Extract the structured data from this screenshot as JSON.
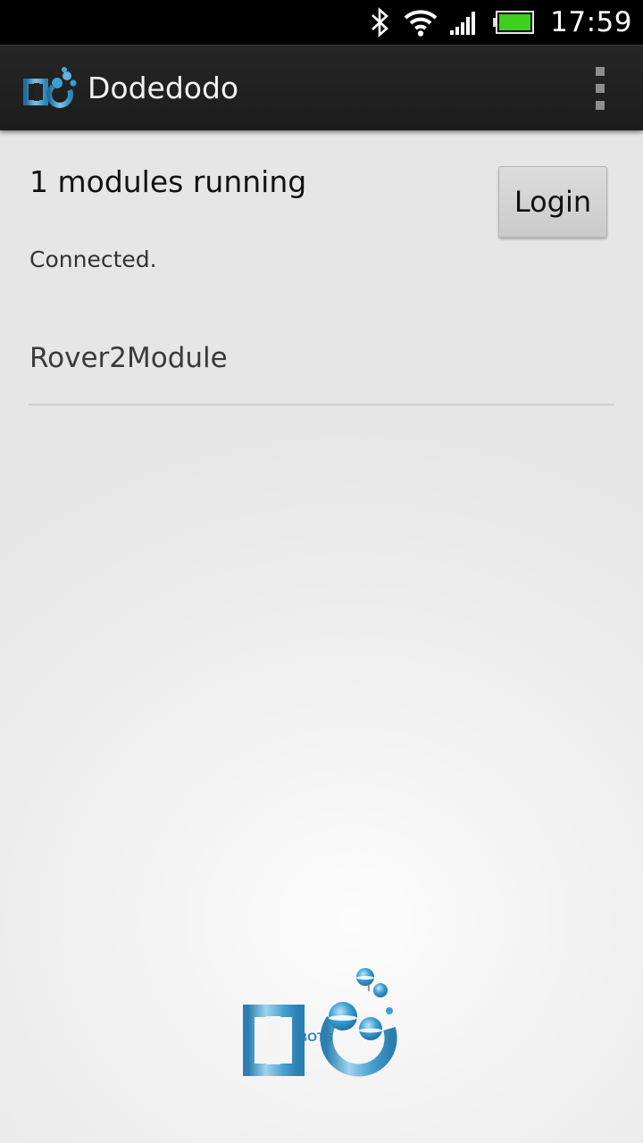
{
  "status_bar": {
    "time": "17:59",
    "icons": [
      "bluetooth-icon",
      "wifi-icon",
      "signal-icon",
      "battery-icon"
    ],
    "battery_color": "#3fcf1f"
  },
  "action_bar": {
    "title": "Dodedodo",
    "logo_text": "BOTS",
    "menu_icon": "overflow-menu-icon"
  },
  "main": {
    "modules_running": "1 modules running",
    "login_label": "Login",
    "connection_status": "Connected.",
    "modules": [
      {
        "name": "Rover2Module"
      }
    ]
  },
  "footer": {
    "logo_text": "BOTS"
  },
  "colors": {
    "accent_blue": "#3a9fd3",
    "action_bar": "#222222",
    "background": "#ececec"
  }
}
